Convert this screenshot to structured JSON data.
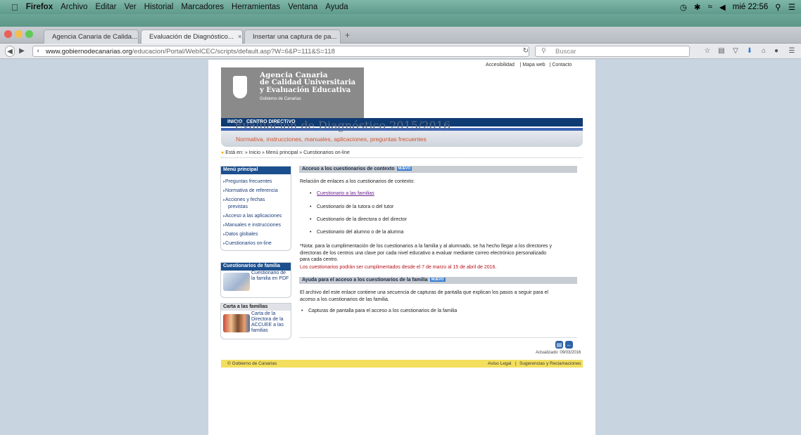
{
  "menubar": {
    "app": "Firefox",
    "items": [
      "Archivo",
      "Editar",
      "Ver",
      "Historial",
      "Marcadores",
      "Herramientas",
      "Ventana",
      "Ayuda"
    ],
    "clock": "mié 22:56"
  },
  "tabs": [
    {
      "label": "Agencia Canaria de Calida...",
      "close": "×"
    },
    {
      "label": "Evaluación de Diagnóstico...",
      "close": "×"
    },
    {
      "label": "Insertar una captura de pa...",
      "close": "×"
    }
  ],
  "new_tab": "+",
  "nav": {
    "url_host": "www.gobiernodecanarias.org",
    "url_path": "/educacion/Portal/WebICEC/scripts/default.asp?W=6&P=111&S=118",
    "search_placeholder": "Buscar"
  },
  "site": {
    "logo_lines": [
      "Agencia Canaria",
      "de Calidad Universitaria",
      "y Evaluación Educativa"
    ],
    "logo_sub": "Gobierno de Canarias",
    "top_links": [
      "Accesibilidad",
      "Mapa web",
      "Contacto"
    ],
    "nav_tabs": [
      "INICIO",
      "CENTRO DIRECTIVO"
    ],
    "title": "Evaluación de Diagnóstico 2015/2016",
    "subtitle": "Normativa, instrucciones, manuales, aplicaciones, preguntas frecuentes",
    "breadcrumb_prefix": "Está en:",
    "breadcrumb": "» Inicio » Menú principal » Cuestionarios on-line"
  },
  "menu": {
    "title": "Menú principal",
    "items": [
      "Preguntas frecuentes",
      "Normativa de referencia",
      "Acciones y fechas",
      "previstas",
      "Acceso a las aplicaciones",
      "Manuales e instrucciones",
      "Datos globales",
      "Cuestionarios on-line"
    ]
  },
  "cuest_box": {
    "title": "Cuestionarios de familia",
    "lines": [
      "Cuestionario de",
      "la familia en PDF"
    ]
  },
  "carta_box": {
    "title": "Carta a las familias",
    "lines": [
      "Carta de la",
      "Directora de la",
      "ACCUEE a las",
      "familias"
    ]
  },
  "section1": {
    "title": "Acceso a los cuestionarios de contexto",
    "badge": "NUEVO",
    "intro": "Relación de enlaces a los cuestionarios de contexto:",
    "links": [
      "Cuestionario a las familias",
      "Cuestionario de la tutora o del tutor",
      "Cuestionario de la directora o del director",
      "Cuestionario del alumno o de la alumna"
    ],
    "note_lines": [
      "*Nota: para la cumplimentación de los cuestionarios a la familia y al alumnado, se ha hecho llegar a los directores y",
      "directoras de los centros una clave por cada nivel educativo a evaluar mediante correo electrónico personalizado",
      "para cada centro."
    ],
    "dates": "Los cuestionarios podrán ser cumplimentados desde el 7 de marzo al 15 de abril de 2016."
  },
  "section2": {
    "title": "Ayuda para el acceso a los cuestionarios de la familia",
    "badge": "NUEVO",
    "text_lines": [
      "El archivo del este enlace contiene una secuencia de capturas de pantalla que explican los pasos a seguir para el",
      "acceso a los cuestionarios de las familia."
    ],
    "link": "Capturas de pantalla para el acceso a los cuestionarios de la familia"
  },
  "footer": {
    "updated": "Actualizado: 09/03/2016",
    "copyright": "© Gobierno de Canarias",
    "links": [
      "Aviso Legal",
      "Sugerencias y Reclamaciones"
    ]
  },
  "colors": {
    "header_blue": "#0f3b73",
    "accent_orange": "#d0542c",
    "date_red": "#b3111c",
    "footer_yellow": "#f3df5d"
  }
}
